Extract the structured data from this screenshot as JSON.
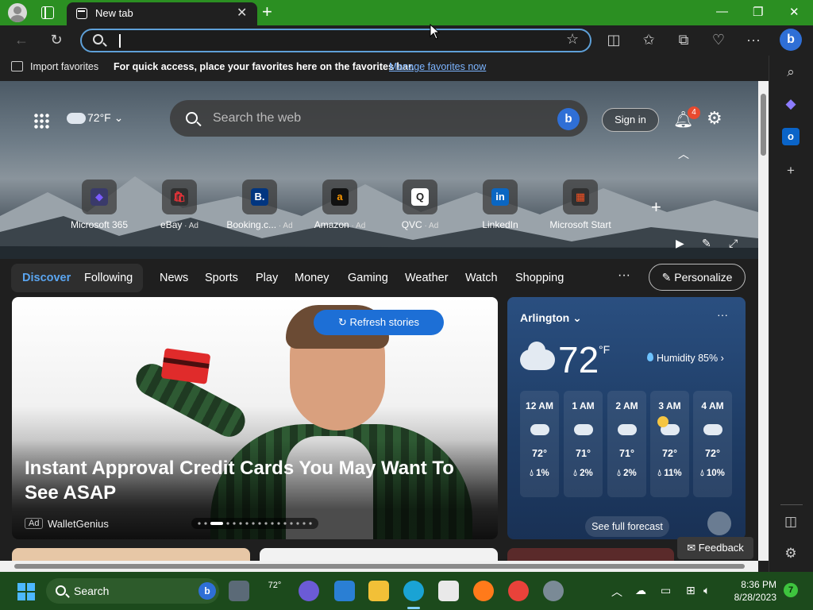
{
  "browser": {
    "tab_title": "New tab",
    "tab_close": "✕",
    "new_tab": "+",
    "window_controls": {
      "minimize": "—",
      "restore": "❐",
      "close": "✕"
    },
    "address_value": "",
    "bing": "b"
  },
  "favorites_bar": {
    "import_label": "Import favorites",
    "message": "For quick access, place your favorites here on the favorites bar.",
    "manage_link": "Manage favorites now"
  },
  "header": {
    "weather_temp": "72°F",
    "search_placeholder": "Search the web",
    "sign_in": "Sign in",
    "notification_count": "4"
  },
  "quick_links": [
    {
      "label": "Microsoft 365",
      "ad": "",
      "glyph": "◆",
      "color": "#7b5cff",
      "bg": "#3a3a6a"
    },
    {
      "label": "eBay",
      "ad": " · Ad",
      "glyph": "🛍",
      "color": "#e53238",
      "bg": "#303030"
    },
    {
      "label": "Booking.c...",
      "ad": " · Ad",
      "glyph": "B.",
      "color": "#ffffff",
      "bg": "#003580"
    },
    {
      "label": "Amazon",
      "ad": " · Ad",
      "glyph": "a",
      "color": "#ff9900",
      "bg": "#111111"
    },
    {
      "label": "QVC",
      "ad": " · Ad",
      "glyph": "Q",
      "color": "#222222",
      "bg": "#ffffff"
    },
    {
      "label": "LinkedIn",
      "ad": "",
      "glyph": "in",
      "color": "#ffffff",
      "bg": "#0a66c2"
    },
    {
      "label": "Microsoft Start",
      "ad": "",
      "glyph": "▦",
      "color": "#f25022",
      "bg": "#303030"
    }
  ],
  "discover_nav": {
    "tabs": [
      "Discover",
      "Following",
      "News",
      "Sports",
      "Play",
      "Money",
      "Gaming",
      "Weather",
      "Watch",
      "Shopping"
    ],
    "more": "···",
    "personalize": "Personalize"
  },
  "feature_card": {
    "refresh": "Refresh stories",
    "title": "Instant Approval Credit Cards You May Want To See ASAP",
    "ad_badge": "Ad",
    "source": "WalletGenius"
  },
  "weather": {
    "city": "Arlington",
    "more": "···",
    "temp": "72",
    "unit": "°F",
    "humidity": "Humidity 85%",
    "hourly": [
      {
        "time": "12 AM",
        "temp": "72°",
        "precip": "1%",
        "icon": "cloud-icon"
      },
      {
        "time": "1 AM",
        "temp": "71°",
        "precip": "2%",
        "icon": "cloud-icon"
      },
      {
        "time": "2 AM",
        "temp": "71°",
        "precip": "2%",
        "icon": "cloud-icon"
      },
      {
        "time": "3 AM",
        "temp": "72°",
        "precip": "11%",
        "icon": "partly-cloudy-icon"
      },
      {
        "time": "4 AM",
        "temp": "72°",
        "precip": "10%",
        "icon": "cloud-icon"
      }
    ],
    "forecast_button": "See full forecast"
  },
  "feedback": "Feedback",
  "taskbar": {
    "search_label": "Search",
    "weather_temp": "72°",
    "time": "8:36 PM",
    "date": "8/28/2023",
    "notification_count": "7"
  },
  "colors": {
    "title_bar": "#2b8f22",
    "taskbar": "#1c4a1c",
    "accent": "#1d6fd6",
    "link": "#7cb4ff"
  }
}
